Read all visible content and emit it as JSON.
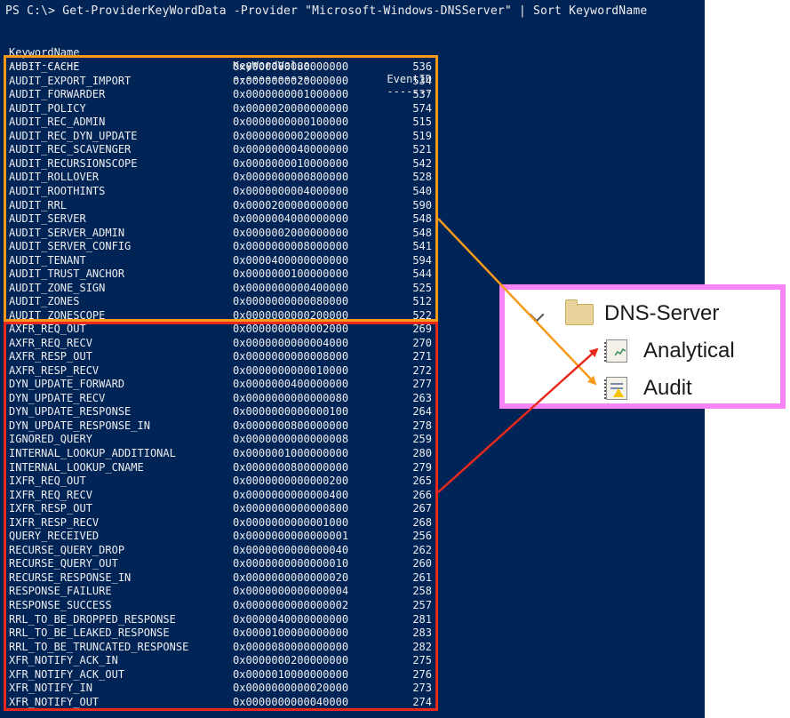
{
  "console": {
    "command_line": "PS C:\\> Get-ProviderKeyWordData -Provider \"Microsoft-Windows-DNSServer\" | Sort KeywordName",
    "headers": [
      "KeywordName",
      "KeyWordValue",
      "EventID"
    ],
    "underlines": [
      "-----------",
      "------------",
      "-------"
    ],
    "audit_rows": [
      {
        "name": "AUDIT_CACHE",
        "value": "0x0000000080000000",
        "id": "536"
      },
      {
        "name": "AUDIT_EXPORT_IMPORT",
        "value": "0x0000000020000000",
        "id": "534"
      },
      {
        "name": "AUDIT_FORWARDER",
        "value": "0x0000000001000000",
        "id": "537"
      },
      {
        "name": "AUDIT_POLICY",
        "value": "0x0000020000000000",
        "id": "574"
      },
      {
        "name": "AUDIT_REC_ADMIN",
        "value": "0x0000000000100000",
        "id": "515"
      },
      {
        "name": "AUDIT_REC_DYN_UPDATE",
        "value": "0x0000000002000000",
        "id": "519"
      },
      {
        "name": "AUDIT_REC_SCAVENGER",
        "value": "0x0000000040000000",
        "id": "521"
      },
      {
        "name": "AUDIT_RECURSIONSCOPE",
        "value": "0x0000000010000000",
        "id": "542"
      },
      {
        "name": "AUDIT_ROLLOVER",
        "value": "0x0000000000800000",
        "id": "528"
      },
      {
        "name": "AUDIT_ROOTHINTS",
        "value": "0x0000000004000000",
        "id": "540"
      },
      {
        "name": "AUDIT_RRL",
        "value": "0x0000200000000000",
        "id": "590"
      },
      {
        "name": "AUDIT_SERVER",
        "value": "0x0000004000000000",
        "id": "548"
      },
      {
        "name": "AUDIT_SERVER_ADMIN",
        "value": "0x0000002000000000",
        "id": "548"
      },
      {
        "name": "AUDIT_SERVER_CONFIG",
        "value": "0x0000000008000000",
        "id": "541"
      },
      {
        "name": "AUDIT_TENANT",
        "value": "0x0000400000000000",
        "id": "594"
      },
      {
        "name": "AUDIT_TRUST_ANCHOR",
        "value": "0x0000000100000000",
        "id": "544"
      },
      {
        "name": "AUDIT_ZONE_SIGN",
        "value": "0x0000000000400000",
        "id": "525"
      },
      {
        "name": "AUDIT_ZONES",
        "value": "0x0000000000080000",
        "id": "512"
      },
      {
        "name": "AUDIT_ZONESCOPE",
        "value": "0x0000000000200000",
        "id": "522"
      }
    ],
    "analytical_rows": [
      {
        "name": "AXFR_REQ_OUT",
        "value": "0x0000000000002000",
        "id": "269"
      },
      {
        "name": "AXFR_REQ_RECV",
        "value": "0x0000000000004000",
        "id": "270"
      },
      {
        "name": "AXFR_RESP_OUT",
        "value": "0x0000000000008000",
        "id": "271"
      },
      {
        "name": "AXFR_RESP_RECV",
        "value": "0x0000000000010000",
        "id": "272"
      },
      {
        "name": "DYN_UPDATE_FORWARD",
        "value": "0x0000000400000000",
        "id": "277"
      },
      {
        "name": "DYN_UPDATE_RECV",
        "value": "0x0000000000000080",
        "id": "263"
      },
      {
        "name": "DYN_UPDATE_RESPONSE",
        "value": "0x0000000000000100",
        "id": "264"
      },
      {
        "name": "DYN_UPDATE_RESPONSE_IN",
        "value": "0x0000000800000000",
        "id": "278"
      },
      {
        "name": "IGNORED_QUERY",
        "value": "0x0000000000000008",
        "id": "259"
      },
      {
        "name": "INTERNAL_LOOKUP_ADDITIONAL",
        "value": "0x0000001000000000",
        "id": "280"
      },
      {
        "name": "INTERNAL_LOOKUP_CNAME",
        "value": "0x0000000800000000",
        "id": "279"
      },
      {
        "name": "IXFR_REQ_OUT",
        "value": "0x0000000000000200",
        "id": "265"
      },
      {
        "name": "IXFR_REQ_RECV",
        "value": "0x0000000000000400",
        "id": "266"
      },
      {
        "name": "IXFR_RESP_OUT",
        "value": "0x0000000000000800",
        "id": "267"
      },
      {
        "name": "IXFR_RESP_RECV",
        "value": "0x0000000000001000",
        "id": "268"
      },
      {
        "name": "QUERY_RECEIVED",
        "value": "0x0000000000000001",
        "id": "256"
      },
      {
        "name": "RECURSE_QUERY_DROP",
        "value": "0x0000000000000040",
        "id": "262"
      },
      {
        "name": "RECURSE_QUERY_OUT",
        "value": "0x0000000000000010",
        "id": "260"
      },
      {
        "name": "RECURSE_RESPONSE_IN",
        "value": "0x0000000000000020",
        "id": "261"
      },
      {
        "name": "RESPONSE_FAILURE",
        "value": "0x0000000000000004",
        "id": "258"
      },
      {
        "name": "RESPONSE_SUCCESS",
        "value": "0x0000000000000002",
        "id": "257"
      },
      {
        "name": "RRL_TO_BE_DROPPED_RESPONSE",
        "value": "0x0000040000000000",
        "id": "281"
      },
      {
        "name": "RRL_TO_BE_LEAKED_RESPONSE",
        "value": "0x0000100000000000",
        "id": "283"
      },
      {
        "name": "RRL_TO_BE_TRUNCATED_RESPONSE",
        "value": "0x0000080000000000",
        "id": "282"
      },
      {
        "name": "XFR_NOTIFY_ACK_IN",
        "value": "0x0000000200000000",
        "id": "275"
      },
      {
        "name": "XFR_NOTIFY_ACK_OUT",
        "value": "0x0000010000000000",
        "id": "276"
      },
      {
        "name": "XFR_NOTIFY_IN",
        "value": "0x0000000000020000",
        "id": "273"
      },
      {
        "name": "XFR_NOTIFY_OUT",
        "value": "0x0000000000040000",
        "id": "274"
      }
    ]
  },
  "tree": {
    "root_label": "DNS-Server",
    "children": [
      {
        "label": "Analytical",
        "icon": "analytical-log-icon"
      },
      {
        "label": "Audit",
        "icon": "audit-log-icon"
      }
    ]
  },
  "colors": {
    "console_bg": "#012456",
    "audit_highlight": "#f79a1a",
    "analytical_highlight": "#e8291c",
    "panel_border": "#f784f7"
  }
}
